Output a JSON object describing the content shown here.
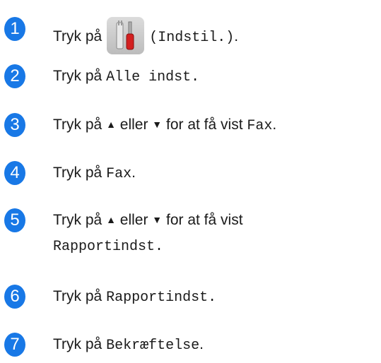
{
  "accent_color": "#1878e6",
  "steps": [
    {
      "number": "1",
      "prefix": "Tryk på",
      "icon": "settings-tools-icon",
      "suffix": "(Indstil.)",
      "end": "."
    },
    {
      "number": "2",
      "prefix": "Tryk på ",
      "code": "Alle indst."
    },
    {
      "number": "3",
      "prefix": "Tryk på ",
      "up": "▲",
      "mid": " eller ",
      "down": "▼",
      "after": " for at få vist ",
      "code": "Fax",
      "end": "."
    },
    {
      "number": "4",
      "prefix": "Tryk på ",
      "code": "Fax",
      "end": "."
    },
    {
      "number": "5",
      "prefix": "Tryk på ",
      "up": "▲",
      "mid": " eller ",
      "down": "▼",
      "after": " for at få vist",
      "code": "Rapportindst."
    },
    {
      "number": "6",
      "prefix": "Tryk på ",
      "code": "Rapportindst."
    },
    {
      "number": "7",
      "prefix": "Tryk på ",
      "code": "Bekræftelse",
      "end": "."
    }
  ]
}
